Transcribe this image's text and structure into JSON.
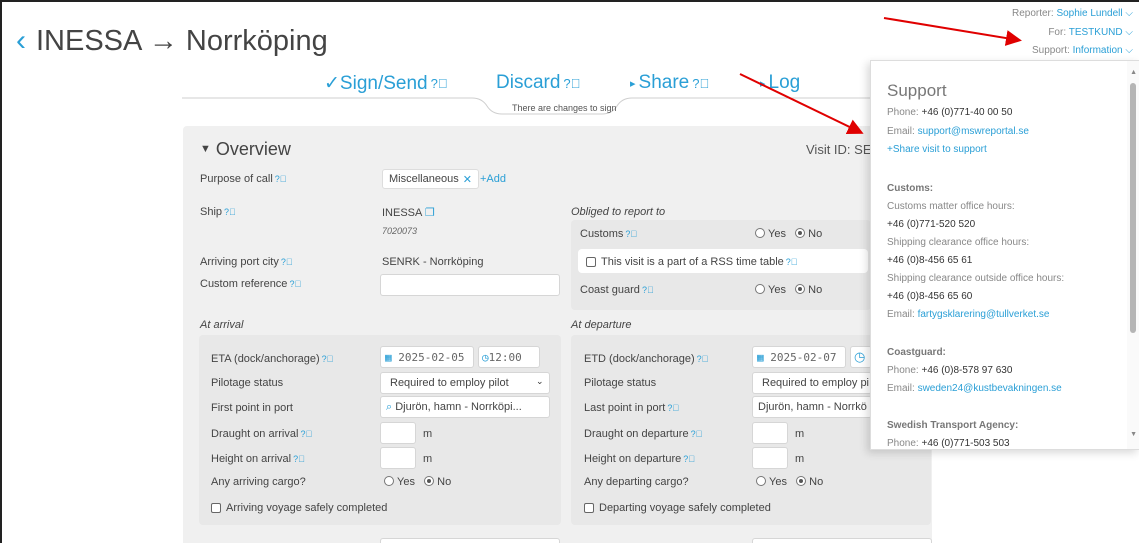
{
  "header": {
    "title": "INESSA → Norrköping",
    "reporter_label": "Reporter:",
    "reporter": "Sophie Lundell",
    "for_label": "For:",
    "for": "TESTKUND",
    "support_label": "Support:",
    "support": "Information"
  },
  "actions": {
    "sign_send": "✓Sign/Send",
    "discard": "Discard",
    "share": "Share",
    "log": "Log",
    "changes_notice": "There are changes to sign"
  },
  "overview": {
    "heading": "Overview",
    "visit_id_label": "Visit ID: SE",
    "purpose_label": "Purpose of call",
    "purpose_value": "Miscellaneous",
    "add_label": "+Add",
    "ship_label": "Ship",
    "ship_name": "INESSA",
    "ship_number": "7020073",
    "arriving_port_label": "Arriving port city",
    "arriving_port_value": "SENRK - Norrköping",
    "custom_reference_label": "Custom reference",
    "custom_reference_value": "",
    "obliged_label": "Obliged to report to",
    "customs_label": "Customs",
    "rss_label": "This visit is a part of a RSS time table",
    "coast_guard_label": "Coast guard",
    "yes": "Yes",
    "no": "No"
  },
  "arrival": {
    "section": "At arrival",
    "eta_label": "ETA (dock/anchorage)",
    "eta_date": "2025-02-05",
    "eta_time": "12:00",
    "pilotage_label": "Pilotage status",
    "pilotage_value": "Required to employ pilot",
    "first_point_label": "First point in port",
    "first_point_value": "Djurön, hamn - Norrköpi...",
    "draught_label": "Draught on arrival",
    "draught_unit": "m",
    "height_label": "Height on arrival",
    "height_unit": "m",
    "cargo_label": "Any arriving cargo?",
    "completed_label": "Arriving voyage safely completed"
  },
  "departure": {
    "section": "At departure",
    "etd_label": "ETD (dock/anchorage)",
    "etd_date": "2025-02-07",
    "pilotage_label": "Pilotage status",
    "pilotage_value": "Required to employ pi",
    "last_point_label": "Last point in port",
    "last_point_value": "Djurön, hamn - Norrkö",
    "draught_label": "Draught on departure",
    "draught_unit": "m",
    "height_label": "Height on departure",
    "height_unit": "m",
    "cargo_label": "Any departing cargo?",
    "completed_label": "Departing voyage safely completed"
  },
  "support_panel": {
    "title": "Support",
    "phone_label": "Phone:",
    "phone": "+46 (0)771-40 00 50",
    "email_label": "Email:",
    "email": "support@mswreportal.se",
    "share_link": "+Share visit to support",
    "customs_head": "Customs:",
    "customs_office_hours_label": "Customs matter office hours:",
    "customs_office_phone": "+46 (0)771-520 520",
    "shipping_clearance_label": "Shipping clearance office hours:",
    "shipping_clearance_phone": "+46 (0)8-456 65 61",
    "shipping_outside_label": "Shipping clearance outside office hours:",
    "shipping_outside_phone": "+46 (0)8-456 65 60",
    "customs_email": "fartygsklarering@tullverket.se",
    "coastguard_head": "Coastguard:",
    "coastguard_phone": "+46 (0)8-578 97 630",
    "coastguard_email": "sweden24@kustbevakningen.se",
    "transport_head": "Swedish Transport Agency:",
    "transport_phone": "+46 (0)771-503 503"
  },
  "colors": {
    "accent": "#2a9fd6",
    "annotation_arrow": "#e00000",
    "panel_bg": "#f0f0f0"
  }
}
